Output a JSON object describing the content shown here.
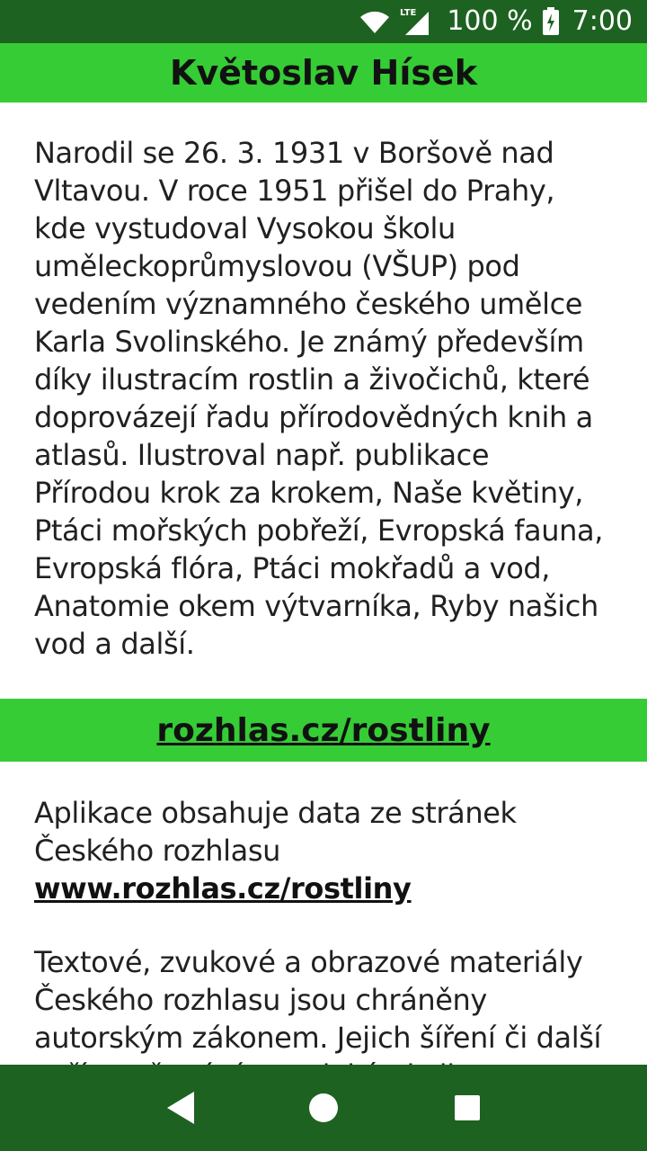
{
  "status_bar": {
    "network": "LTE",
    "battery": "100 %",
    "time": "7:00",
    "icons": [
      "wifi-icon",
      "signal-icon",
      "battery-icon"
    ]
  },
  "header": {
    "title": "Květoslav Hísek"
  },
  "bio": {
    "text": "Narodil se 26. 3. 1931 v Boršově nad Vltavou. V roce 1951 přišel do Prahy, kde vystudoval Vysokou školu uměleckoprůmyslovou (VŠUP) pod vedením významného českého umělce Karla Svolinského. Je známý především díky ilustracím rostlin a živočichů, které doprovázejí řadu přírodovědných knih a atlasů. Ilustroval např. publikace Přírodou krok za krokem, Naše květiny, Ptáci mořských pobřeží, Evropská fauna, Evropská flóra, Ptáci mokřadů a vod, Anatomie okem výtvarníka, Ryby našich vod a další."
  },
  "link_section": {
    "label": "rozhlas.cz/rostliny"
  },
  "source": {
    "text": "Aplikace obsahuje data ze stránek Českého rozhlasu",
    "url": "www.rozhlas.cz/rostliny"
  },
  "legal": {
    "text": "Textové, zvukové a obrazové materiály Českého rozhlasu jsou chráněny autorským zákonem. Jejich šíření či další zpřístupňování, a to jakýmkoliv"
  },
  "nav_bar": {
    "buttons": [
      "back",
      "home",
      "recents"
    ]
  },
  "colors": {
    "accent_green": "#35cc35",
    "dark_green": "#1e6222"
  }
}
